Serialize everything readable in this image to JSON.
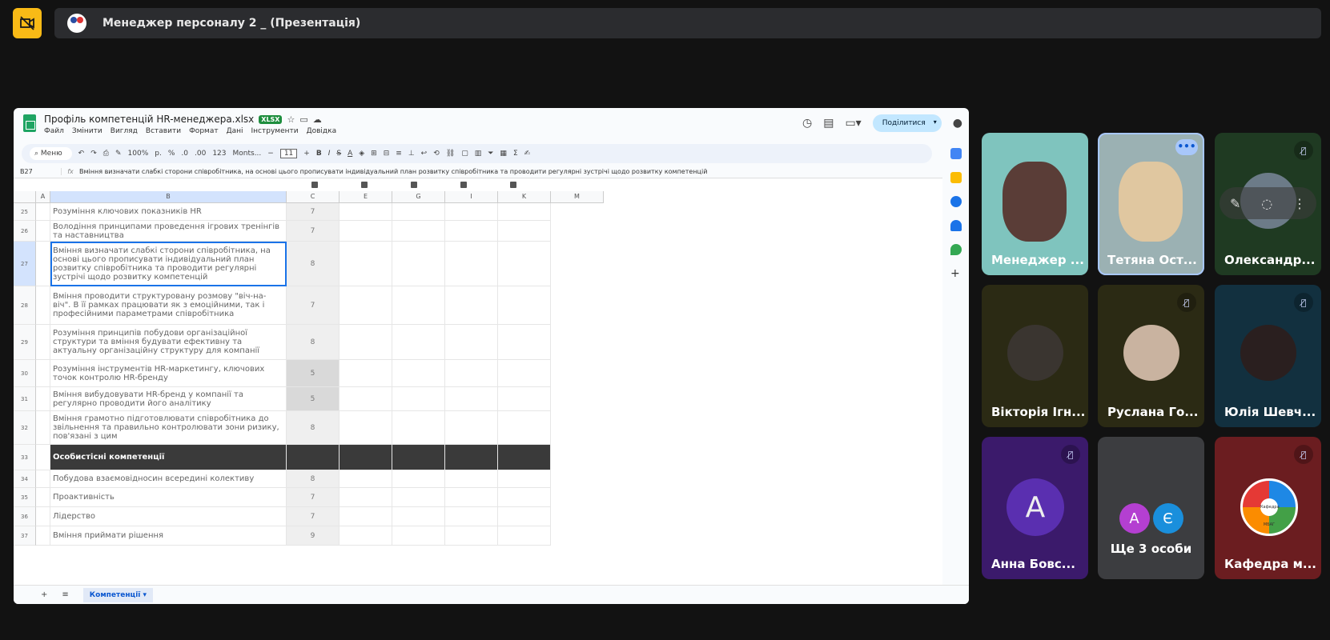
{
  "meeting": {
    "title": "Менеджер персоналу 2 _ (Презентація)"
  },
  "sheet": {
    "filename": "Профіль компетенцій HR-менеджера.xlsx",
    "badge": "XLSX",
    "menus": [
      "Файл",
      "Змінити",
      "Вигляд",
      "Вставити",
      "Формат",
      "Дані",
      "Інструменти",
      "Довідка"
    ],
    "share_label": "Поділитися",
    "toolbar": {
      "search": "Меню",
      "zoom": "100%",
      "currency": "р.",
      "percent": "%",
      "dec_less": ".0",
      "dec_more": ".00",
      "num": "123",
      "font": "Monts...",
      "size": "11"
    },
    "cell_ref": "B27",
    "formula": "Вміння визначати слабкі сторони співробітника, на основі цього прописувати індивідуальний план розвитку співробітника та проводити регулярні зустрічі щодо розвитку компетенцій",
    "columns": [
      "A",
      "B",
      "C",
      "E",
      "G",
      "I",
      "K",
      "M"
    ],
    "rows": [
      {
        "n": "25",
        "b": "Розуміння ключових показників HR",
        "c": "7",
        "h": 22
      },
      {
        "n": "26",
        "b": "Володіння принципами проведення ігрових тренінгів та наставництва",
        "c": "7",
        "h": 26
      },
      {
        "n": "27",
        "b": "Вміння визначати слабкі сторони співробітника, на основі цього прописувати індивідуальний план розвитку співробітника та проводити регулярні зустрічі щодо розвитку компетенцій",
        "c": "8",
        "h": 56,
        "selected": true
      },
      {
        "n": "28",
        "b": "Вміння проводити структуровану розмову \"віч-на-віч\". В її рамках працювати як з емоційними, так і професійними параметрами співробітника",
        "c": "7",
        "h": 48
      },
      {
        "n": "29",
        "b": "Розуміння принципів побудови організаційної структури та вміння будувати ефективну та актуальну організаційну структуру для компанії",
        "c": "8",
        "h": 44
      },
      {
        "n": "30",
        "b": "Розуміння інструментів HR-маркетингу, ключових точок контролю HR-бренду",
        "c": "5",
        "h": 34,
        "dark": true
      },
      {
        "n": "31",
        "b": "Вміння вибудовувати HR-бренд у компанії та регулярно проводити його аналітику",
        "c": "5",
        "h": 30,
        "dark": true
      },
      {
        "n": "32",
        "b": "Вміння грамотно підготовлювати співробітника до звільнення та правильно контролювати зони ризику, пов'язані з цим",
        "c": "8",
        "h": 42
      },
      {
        "n": "33",
        "b": "Особистісні компетенції",
        "c": "",
        "h": 32,
        "section": true
      },
      {
        "n": "34",
        "b": "Побудова взаємовідносин всередині колективу",
        "c": "8",
        "h": 22
      },
      {
        "n": "35",
        "b": "Проактивність",
        "c": "7",
        "h": 24
      },
      {
        "n": "36",
        "b": "Лідерство",
        "c": "7",
        "h": 24
      },
      {
        "n": "37",
        "b": "Вміння приймати рішення",
        "c": "9",
        "h": 24
      }
    ],
    "sheet_tab": "Компетенції"
  },
  "participants": [
    {
      "name": "Менеджер ...",
      "bg": "#7fc4be",
      "kind": "video"
    },
    {
      "name": "Тетяна Ост...",
      "bg": "#9bb1b3",
      "kind": "video",
      "more": "•••"
    },
    {
      "name": "Олександр...",
      "bg": "#1f3a22",
      "kind": "avatar",
      "avatar_color": "#6c7b88",
      "muted": true
    },
    {
      "name": "Вікторія Ігн...",
      "bg": "#2b2a14",
      "kind": "avatar",
      "avatar_color": "#3a3530"
    },
    {
      "name": "Руслана Го...",
      "bg": "#2b2a14",
      "kind": "avatar",
      "avatar_color": "#c9b3a0",
      "muted": true
    },
    {
      "name": "Юлія Шевч...",
      "bg": "#12303f",
      "kind": "avatar",
      "avatar_color": "#2a1f1f",
      "muted": true
    },
    {
      "name": "Анна Бовс...",
      "bg": "#3b1a6b",
      "kind": "letter",
      "letter": "A",
      "muted": true
    },
    {
      "name": "",
      "bg": "#3c3d40",
      "kind": "more",
      "bubbles": [
        "A",
        "Є"
      ],
      "label": "Ще 3 особи"
    },
    {
      "name": "Кафедра м...",
      "bg": "#6b1d20",
      "kind": "logo",
      "logo_text": "Кафедра МБАГ",
      "muted": true
    }
  ]
}
